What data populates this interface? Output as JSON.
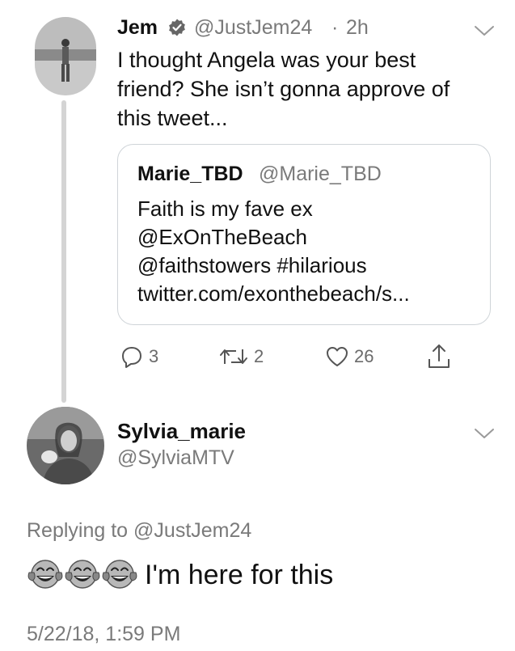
{
  "original_tweet": {
    "display_name": "Jem",
    "handle": "@JustJem24",
    "separator": "·",
    "time_ago": "2h",
    "text": "I thought Angela was your best\nfriend? She isn’t gonna approve of\nthis tweet...",
    "verified_icon": "verified-badge-icon",
    "quoted_tweet": {
      "display_name": "Marie_TBD",
      "handle": "@Marie_TBD",
      "text": "Faith is my fave ex\n@ExOnTheBeach\n@faithstowers #hilarious\ntwitter.com/exonthebeach/s..."
    },
    "actions": {
      "reply_count": "3",
      "retweet_count": "2",
      "like_count": "26"
    }
  },
  "reply_tweet": {
    "display_name": "Sylvia_marie",
    "handle": "@SylviaMTV",
    "replying_to_label": "Replying to",
    "replying_to_handle": "@JustJem24",
    "emojis": [
      "tears-of-joy-emoji",
      "tears-of-joy-emoji",
      "tears-of-joy-emoji"
    ],
    "text": "I'm here for this",
    "timestamp": "5/22/18, 1:59 PM"
  }
}
